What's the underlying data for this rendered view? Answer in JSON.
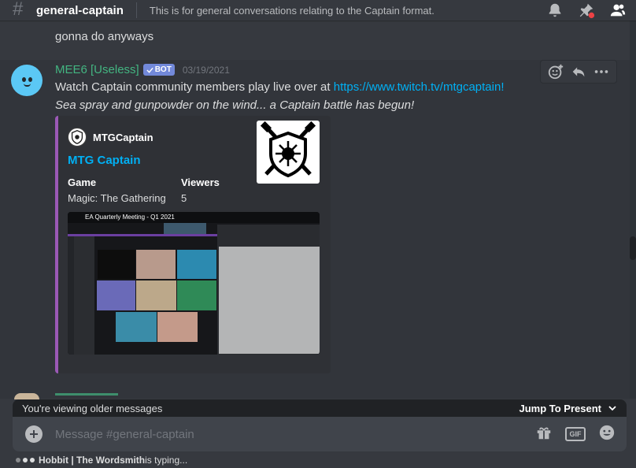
{
  "header": {
    "channel_name": "general-captain",
    "topic": "This is for general conversations relating to the Captain format."
  },
  "previous_message": {
    "text": "gonna do anyways"
  },
  "message": {
    "username": "MEE6 [Useless]",
    "bot_tag": "BOT",
    "timestamp": "03/19/2021",
    "line1_prefix": "Watch Captain community members play live over at ",
    "line1_link": "https://www.twitch.tv/mtgcaptain!",
    "line2": "Sea spray and gunpowder on the wind... a Captain battle has begun!",
    "embed": {
      "author": "MTGCaptain",
      "title": "MTG Captain",
      "fields": [
        {
          "name": "Game",
          "value": "Magic: The Gathering"
        },
        {
          "name": "Viewers",
          "value": "5"
        }
      ],
      "accent_color": "#9b59b6",
      "image": {
        "slide_title": "EA Quarterly Meeting - Q1 2021"
      }
    }
  },
  "older_bar": {
    "text": "You're viewing older messages",
    "jump_label": "Jump To Present"
  },
  "composer": {
    "placeholder": "Message #general-captain",
    "gif_label": "GIF"
  },
  "typing": {
    "user": "Hobbit | The Wordsmith",
    "suffix": " is typing..."
  },
  "colors": {
    "background": "#36393f",
    "link": "#00b0f4",
    "bot_username": "#43b581",
    "bot_tag": "#7289da"
  }
}
